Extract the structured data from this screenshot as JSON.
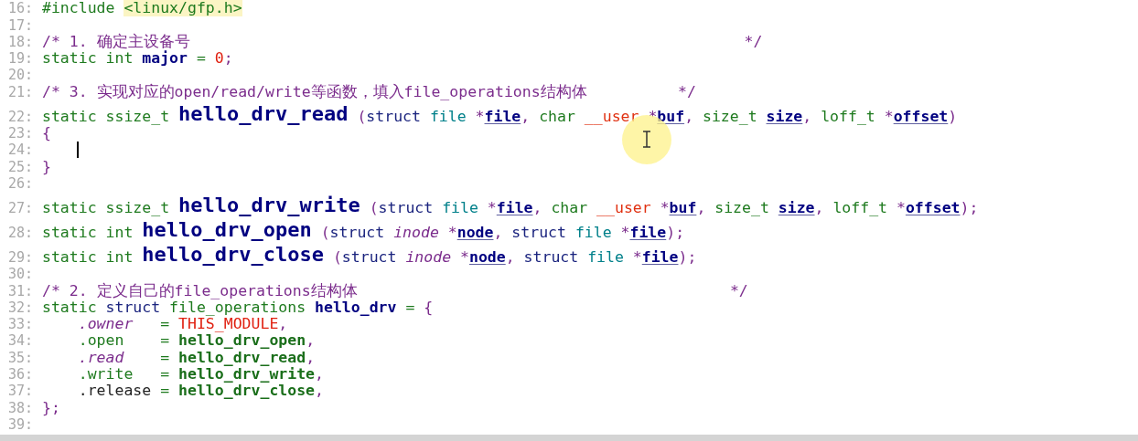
{
  "editor": {
    "lines": [
      {
        "number": "16:",
        "kind": "plain",
        "caret": false,
        "tokens": [
          {
            "kind": "include",
            "text": "#include"
          },
          {
            "kind": "header",
            "text": " <linux/gfp.h>"
          }
        ]
      },
      {
        "number": "17:",
        "kind": "plain",
        "caret": false
      },
      {
        "number": "18:",
        "kind": "plain",
        "caret": false,
        "tokens": [
          {
            "kind": "comment",
            "text": "/* 1. 确定主设备号"
          },
          {
            "kind": "comment",
            "text": "                                                             */"
          }
        ]
      },
      {
        "number": "19:",
        "kind": "plain",
        "caret": false,
        "tokens": [
          {
            "kind": "keyword",
            "text": "static"
          },
          {
            "kind": "keyword",
            "text": " int"
          },
          {
            "kind": "identifier",
            "text": " major"
          },
          {
            "kind": "operator",
            "text": " ="
          },
          {
            "kind": "number",
            "text": " 0"
          },
          {
            "kind": "punct",
            "text": ";"
          }
        ]
      },
      {
        "number": "20:",
        "kind": "plain",
        "caret": false
      },
      {
        "number": "21:",
        "kind": "plain",
        "caret": false,
        "tokens": [
          {
            "kind": "comment",
            "text": "/* 3. 实现对应的open/read/write等函数，填入file_operations结构体"
          },
          {
            "kind": "comment",
            "text": "          */"
          }
        ]
      },
      {
        "number": "22:",
        "kind": "declaration",
        "caret": false,
        "tokens": [
          {
            "kind": "keyword",
            "text": "static"
          },
          {
            "kind": "keyword",
            "text": " ssize_t"
          },
          {
            "kind": "function",
            "text": " hello_drv_read"
          },
          {
            "kind": "punct",
            "text": " ("
          },
          {
            "kind": "struct",
            "text": "struct"
          },
          {
            "kind": "type",
            "text": " file"
          },
          {
            "kind": "punct",
            "text": " *"
          },
          {
            "kind": "param",
            "text": "file"
          },
          {
            "kind": "punct",
            "text": ","
          },
          {
            "kind": "keyword",
            "text": " char"
          },
          {
            "kind": "qualifier",
            "text": " __user"
          },
          {
            "kind": "punct",
            "text": " *"
          },
          {
            "kind": "param",
            "text": "buf"
          },
          {
            "kind": "punct",
            "text": ","
          },
          {
            "kind": "keyword",
            "text": " size_t"
          },
          {
            "kind": "param",
            "text": " size"
          },
          {
            "kind": "punct",
            "text": ","
          },
          {
            "kind": "keyword",
            "text": " loff_t"
          },
          {
            "kind": "punct",
            "text": " *"
          },
          {
            "kind": "param",
            "text": "offset"
          },
          {
            "kind": "punct",
            "text": ")"
          }
        ]
      },
      {
        "number": "23:",
        "kind": "plain",
        "caret": false,
        "tokens": [
          {
            "kind": "punct",
            "text": "{"
          }
        ]
      },
      {
        "number": "24:",
        "kind": "plain",
        "caret": true
      },
      {
        "number": "25:",
        "kind": "plain",
        "caret": false,
        "tokens": [
          {
            "kind": "punct",
            "text": "}"
          }
        ]
      },
      {
        "number": "26:",
        "kind": "plain",
        "caret": false
      },
      {
        "number": "27:",
        "kind": "declaration",
        "caret": false,
        "tokens": [
          {
            "kind": "keyword",
            "text": "static"
          },
          {
            "kind": "keyword",
            "text": " ssize_t"
          },
          {
            "kind": "function",
            "text": " hello_drv_write"
          },
          {
            "kind": "punct",
            "text": " ("
          },
          {
            "kind": "struct",
            "text": "struct"
          },
          {
            "kind": "type",
            "text": " file"
          },
          {
            "kind": "punct",
            "text": " *"
          },
          {
            "kind": "param",
            "text": "file"
          },
          {
            "kind": "punct",
            "text": ","
          },
          {
            "kind": "keyword",
            "text": " char"
          },
          {
            "kind": "qualifier",
            "text": " __user"
          },
          {
            "kind": "punct",
            "text": " *"
          },
          {
            "kind": "param",
            "text": "buf"
          },
          {
            "kind": "punct",
            "text": ","
          },
          {
            "kind": "keyword",
            "text": " size_t"
          },
          {
            "kind": "param",
            "text": " size"
          },
          {
            "kind": "punct",
            "text": ","
          },
          {
            "kind": "keyword",
            "text": " loff_t"
          },
          {
            "kind": "punct",
            "text": " *"
          },
          {
            "kind": "param",
            "text": "offset"
          },
          {
            "kind": "punct",
            "text": ");"
          }
        ]
      },
      {
        "number": "28:",
        "kind": "declaration",
        "caret": false,
        "tokens": [
          {
            "kind": "keyword",
            "text": "static"
          },
          {
            "kind": "keyword",
            "text": " int"
          },
          {
            "kind": "function",
            "text": " hello_drv_open"
          },
          {
            "kind": "punct",
            "text": " ("
          },
          {
            "kind": "struct",
            "text": "struct"
          },
          {
            "kind": "type-italic",
            "text": " inode"
          },
          {
            "kind": "punct",
            "text": " *"
          },
          {
            "kind": "param",
            "text": "node"
          },
          {
            "kind": "punct",
            "text": ","
          },
          {
            "kind": "struct",
            "text": " struct"
          },
          {
            "kind": "type",
            "text": " file"
          },
          {
            "kind": "punct",
            "text": " *"
          },
          {
            "kind": "param",
            "text": "file"
          },
          {
            "kind": "punct",
            "text": ");"
          }
        ]
      },
      {
        "number": "29:",
        "kind": "declaration",
        "caret": false,
        "tokens": [
          {
            "kind": "keyword",
            "text": "static"
          },
          {
            "kind": "keyword",
            "text": " int"
          },
          {
            "kind": "function",
            "text": " hello_drv_close"
          },
          {
            "kind": "punct",
            "text": " ("
          },
          {
            "kind": "struct",
            "text": "struct"
          },
          {
            "kind": "type-italic",
            "text": " inode"
          },
          {
            "kind": "punct",
            "text": " *"
          },
          {
            "kind": "param",
            "text": "node"
          },
          {
            "kind": "punct",
            "text": ","
          },
          {
            "kind": "struct",
            "text": " struct"
          },
          {
            "kind": "type",
            "text": " file"
          },
          {
            "kind": "punct",
            "text": " *"
          },
          {
            "kind": "param",
            "text": "file"
          },
          {
            "kind": "punct",
            "text": ");"
          }
        ]
      },
      {
        "number": "30:",
        "kind": "plain",
        "caret": false
      },
      {
        "number": "31:",
        "kind": "plain",
        "caret": false,
        "tokens": [
          {
            "kind": "comment",
            "text": "/* 2. 定义自己的file_operations结构体"
          },
          {
            "kind": "comment",
            "text": "                                         */"
          }
        ]
      },
      {
        "number": "32:",
        "kind": "plain",
        "caret": false,
        "tokens": [
          {
            "kind": "keyword",
            "text": "static"
          },
          {
            "kind": "struct",
            "text": " struct"
          },
          {
            "kind": "keyword",
            "text": " file_operations"
          },
          {
            "kind": "identifier",
            "text": " hello_drv"
          },
          {
            "kind": "operator",
            "text": " ="
          },
          {
            "kind": "punct",
            "text": " {"
          }
        ]
      },
      {
        "number": "33:",
        "kind": "plain",
        "caret": false,
        "tokens": [
          {
            "kind": "field-italic",
            "text": "    .owner"
          },
          {
            "kind": "operator",
            "text": "   ="
          },
          {
            "kind": "macro",
            "text": " THIS_MODULE"
          },
          {
            "kind": "punct",
            "text": ","
          }
        ]
      },
      {
        "number": "34:",
        "kind": "plain",
        "caret": false,
        "tokens": [
          {
            "kind": "field",
            "text": "    .open"
          },
          {
            "kind": "operator",
            "text": "    ="
          },
          {
            "kind": "value",
            "text": " hello_drv_open"
          },
          {
            "kind": "punct",
            "text": ","
          }
        ]
      },
      {
        "number": "35:",
        "kind": "plain",
        "caret": false,
        "tokens": [
          {
            "kind": "field-italic",
            "text": "    .read"
          },
          {
            "kind": "operator",
            "text": "    ="
          },
          {
            "kind": "value",
            "text": " hello_drv_read"
          },
          {
            "kind": "punct",
            "text": ","
          }
        ]
      },
      {
        "number": "36:",
        "kind": "plain",
        "caret": false,
        "tokens": [
          {
            "kind": "field",
            "text": "    .write"
          },
          {
            "kind": "operator",
            "text": "   ="
          },
          {
            "kind": "value",
            "text": " hello_drv_write"
          },
          {
            "kind": "punct",
            "text": ","
          }
        ]
      },
      {
        "number": "37:",
        "kind": "plain",
        "caret": false,
        "tokens": [
          {
            "kind": "field-plain",
            "text": "    .release"
          },
          {
            "kind": "operator",
            "text": " ="
          },
          {
            "kind": "value",
            "text": " hello_drv_close"
          },
          {
            "kind": "punct",
            "text": ","
          }
        ]
      },
      {
        "number": "38:",
        "kind": "plain",
        "caret": false,
        "tokens": [
          {
            "kind": "punct",
            "text": "};"
          }
        ]
      },
      {
        "number": "39:",
        "kind": "plain",
        "caret": false
      }
    ]
  }
}
